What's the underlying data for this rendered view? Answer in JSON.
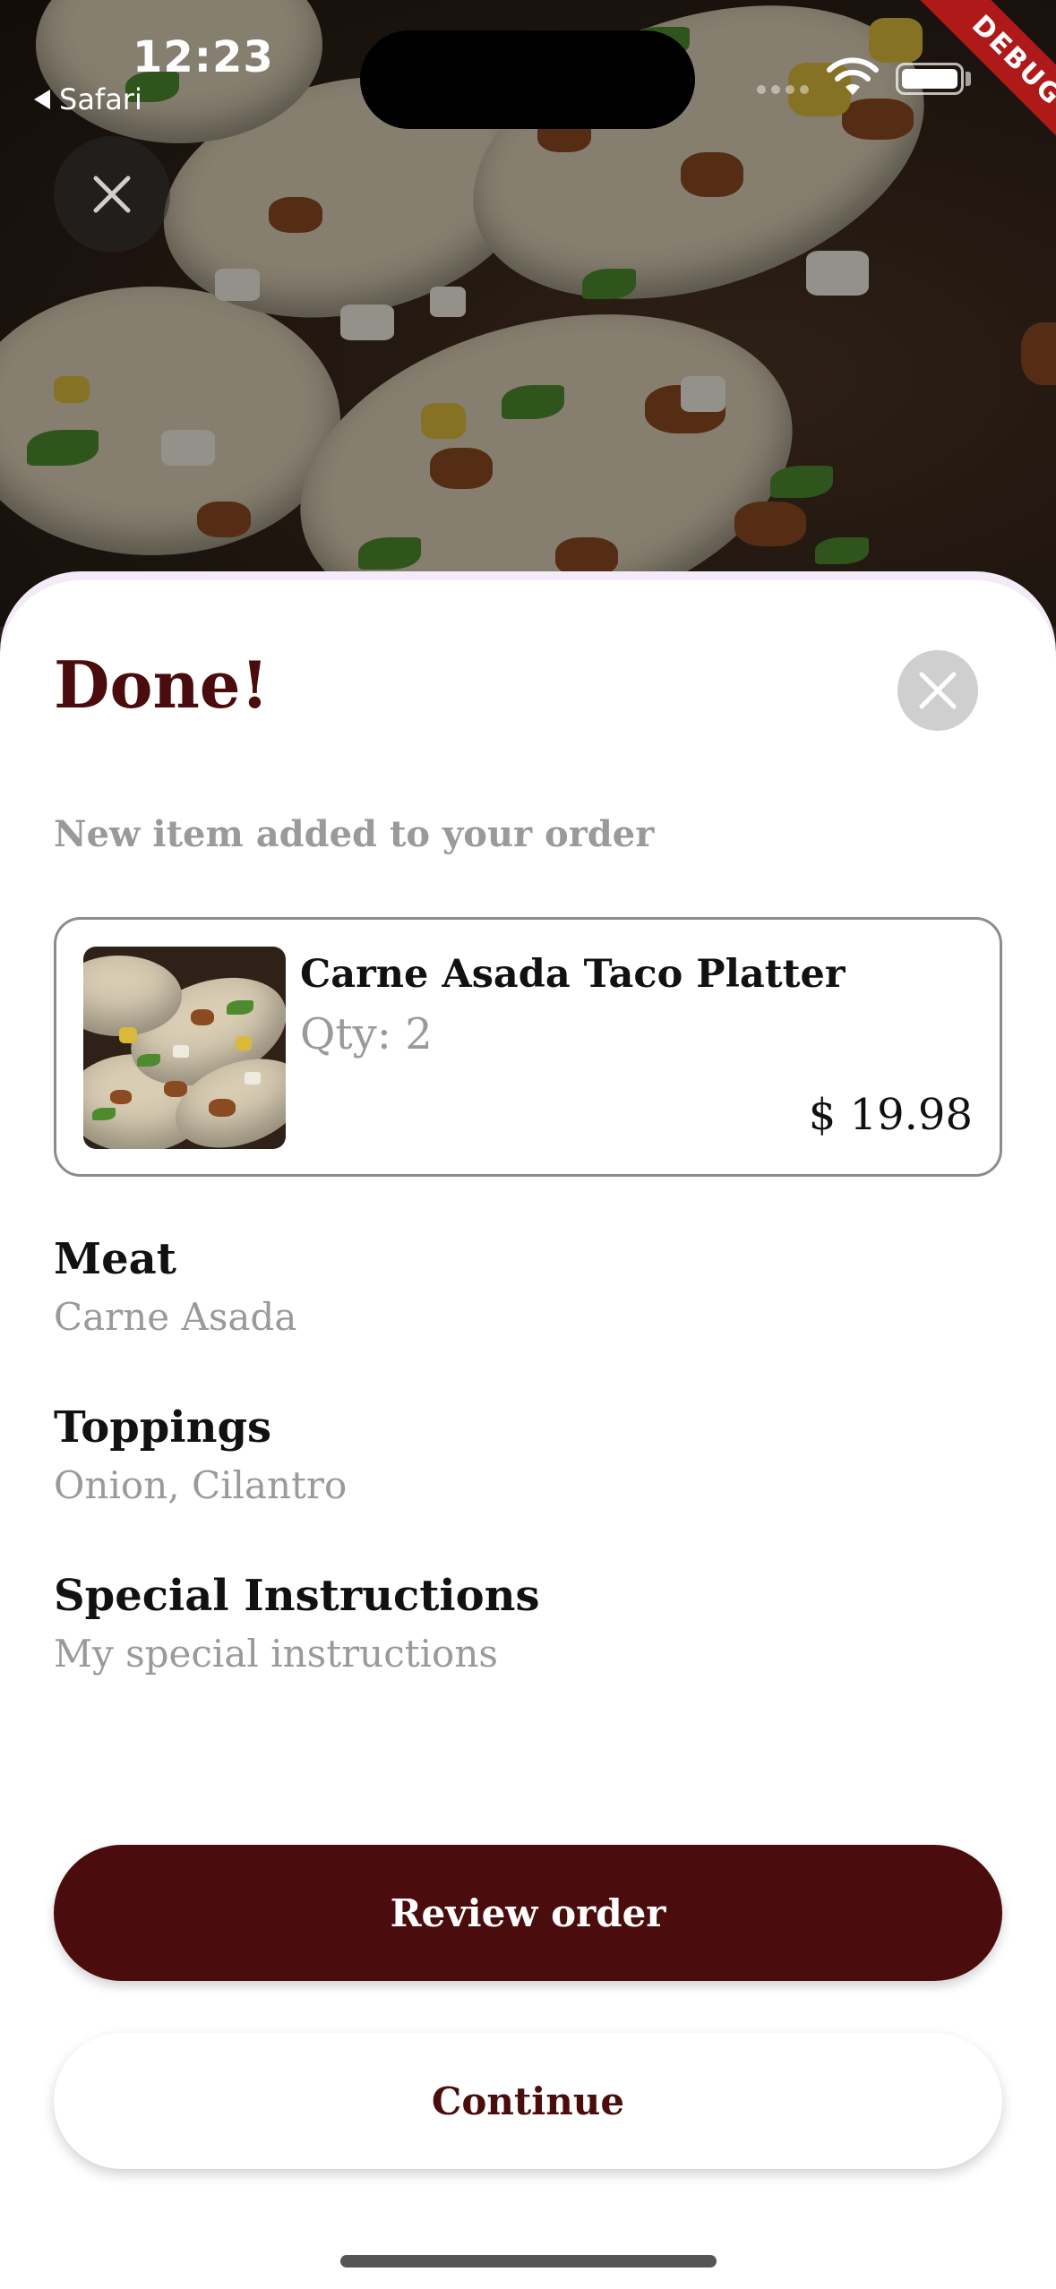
{
  "status_bar": {
    "time": "12:23",
    "back_app": "Safari",
    "debug_label": "DEBUG"
  },
  "sheet": {
    "title": "Done!",
    "subtitle": "New item added to your order",
    "item": {
      "name": "Carne Asada Taco Platter",
      "qty": "Qty: 2",
      "price": "$ 19.98"
    },
    "options": [
      {
        "label": "Meat",
        "value": "Carne Asada"
      },
      {
        "label": "Toppings",
        "value": "Onion, Cilantro"
      },
      {
        "label": "Special Instructions",
        "value": "My special instructions"
      }
    ],
    "primary_button": "Review order",
    "secondary_button": "Continue"
  },
  "colors": {
    "brand": "#4a0c0c",
    "muted_text": "#9a9a9a",
    "debug": "#b0191a"
  },
  "icons": [
    "close-icon",
    "wifi-icon",
    "battery-icon",
    "back-arrow-icon"
  ]
}
